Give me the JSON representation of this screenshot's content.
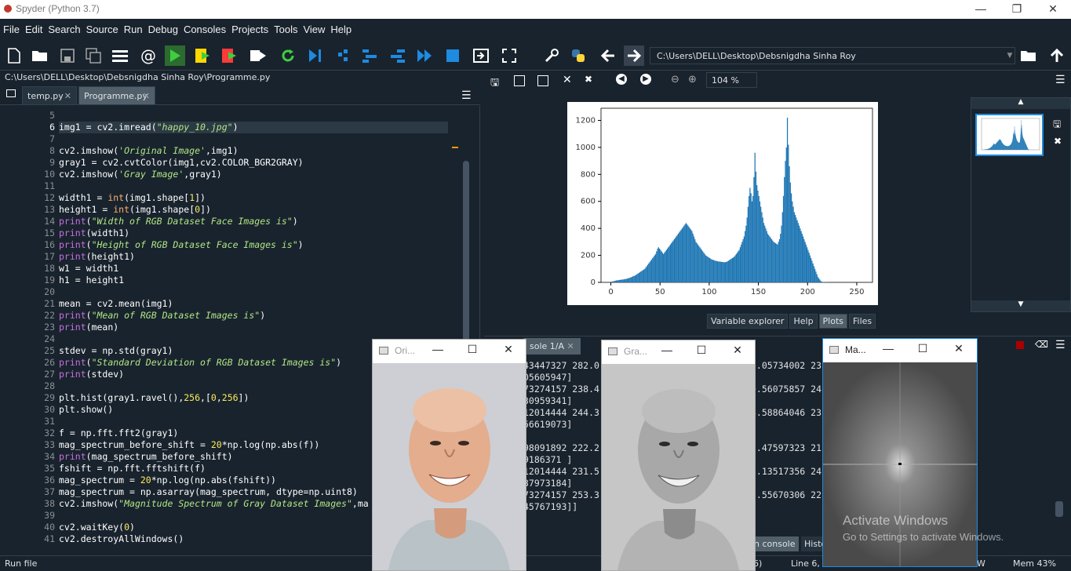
{
  "window": {
    "title": "Spyder (Python 3.7)",
    "min": "—",
    "max": "❐",
    "close": "✕"
  },
  "menu": [
    "File",
    "Edit",
    "Search",
    "Source",
    "Run",
    "Debug",
    "Consoles",
    "Projects",
    "Tools",
    "View",
    "Help"
  ],
  "toolbar": {
    "path": "C:\\Users\\DELL\\Desktop\\Debsnigdha Sinha Roy"
  },
  "editor": {
    "filepath": "C:\\Users\\DELL\\Desktop\\Debsnigdha Sinha Roy\\Programme.py",
    "tabs": [
      "temp.py",
      "Programme.py"
    ],
    "line_numbers": [
      "5",
      "6",
      "7",
      "8",
      "9",
      "10",
      "11",
      "12",
      "13",
      "14",
      "15",
      "16",
      "17",
      "18",
      "19",
      "20",
      "21",
      "22",
      "23",
      "24",
      "25",
      "26",
      "27",
      "28",
      "29",
      "30",
      "31",
      "32",
      "33",
      "34",
      "35",
      "36",
      "37",
      "38",
      "39",
      "40",
      "41"
    ]
  },
  "plots": {
    "zoom": "104 %",
    "tabs": [
      "Variable explorer",
      "Help",
      "Plots",
      "Files"
    ],
    "active_tab": "Plots"
  },
  "console": {
    "tab": "Console 1/A",
    "tab_visible": "sole 1/A",
    "lines": [
      "43447327 282.0",
      "05605947]",
      "73274157 238.4",
      "30959341]",
      "12014444 244.3",
      "56619073]",
      "",
      "98091892 222.2",
      "9186371 ]",
      "12014444 231.5",
      "37973184]",
      "73274157 253.3",
      "45767193]]"
    ],
    "lines_right": [
      "5.05734002 23",
      "",
      "0.56075857 24",
      "",
      "8.58864046 23",
      "",
      "",
      "5.47597323 21",
      "",
      "5.13517356 24",
      "",
      "5.55670306 22",
      ""
    ],
    "bottom_tabs": [
      "IPython console",
      "History"
    ],
    "bottom_tabs_visible": [
      "n console",
      "Histor"
    ]
  },
  "status": {
    "left": "Run file",
    "mid": "6)",
    "pos": "Line 6, C",
    "enc": "W",
    "mem": "Mem 43%"
  },
  "windows": [
    {
      "title": "Ori...",
      "full": "Original Image"
    },
    {
      "title": "Gra...",
      "full": "Gray Image"
    },
    {
      "title": "Ma...",
      "full": "Magnitude Spectrum of Gray Dataset Images"
    }
  ],
  "watermark": {
    "line1": "Activate Windows",
    "line2": "Go to Settings to activate Windows."
  },
  "chart_data": {
    "type": "bar",
    "title": "",
    "xlabel": "",
    "ylabel": "",
    "xlim": [
      -10,
      266
    ],
    "ylim": [
      0,
      1290
    ],
    "xticks": [
      "0",
      "50",
      "100",
      "150",
      "200",
      "250"
    ],
    "yticks": [
      "0",
      "200",
      "400",
      "600",
      "800",
      "1000",
      "1200"
    ],
    "color": "#1f77b4",
    "bins_start": 0,
    "values": [
      5,
      6,
      8,
      10,
      12,
      14,
      15,
      16,
      18,
      18,
      20,
      20,
      22,
      22,
      25,
      25,
      28,
      30,
      32,
      35,
      38,
      40,
      45,
      48,
      50,
      55,
      60,
      65,
      70,
      75,
      80,
      85,
      90,
      95,
      100,
      110,
      120,
      130,
      140,
      150,
      160,
      170,
      180,
      190,
      200,
      210,
      230,
      250,
      260,
      250,
      240,
      230,
      220,
      210,
      220,
      230,
      240,
      250,
      260,
      270,
      280,
      290,
      300,
      310,
      320,
      330,
      340,
      350,
      360,
      370,
      380,
      390,
      400,
      410,
      420,
      430,
      440,
      430,
      420,
      410,
      400,
      390,
      380,
      360,
      340,
      320,
      300,
      290,
      280,
      270,
      260,
      250,
      240,
      230,
      220,
      210,
      200,
      195,
      190,
      185,
      180,
      175,
      170,
      168,
      165,
      162,
      160,
      158,
      156,
      155,
      154,
      153,
      152,
      151,
      150,
      149,
      150,
      152,
      155,
      160,
      165,
      170,
      175,
      180,
      185,
      190,
      200,
      210,
      220,
      230,
      240,
      260,
      280,
      300,
      320,
      340,
      380,
      420,
      480,
      560,
      640,
      700,
      660,
      600,
      640,
      780,
      960,
      820,
      720,
      680,
      640,
      600,
      560,
      520,
      480,
      440,
      420,
      400,
      380,
      360,
      350,
      340,
      330,
      320,
      310,
      300,
      295,
      290,
      285,
      280,
      300,
      320,
      360,
      420,
      520,
      640,
      780,
      900,
      1000,
      1220,
      1020,
      860,
      740,
      660,
      600,
      560,
      520,
      500,
      480,
      460,
      440,
      420,
      400,
      380,
      360,
      340,
      320,
      300,
      280,
      260,
      240,
      220,
      200,
      180,
      160,
      140,
      120,
      100,
      80,
      60,
      40,
      30,
      20,
      10,
      5,
      3,
      2,
      1,
      1,
      1,
      0,
      0,
      0,
      0,
      0,
      0,
      0,
      0,
      0,
      0,
      0,
      0,
      0,
      0,
      0,
      0,
      0,
      0,
      0,
      0,
      0,
      0,
      0,
      0,
      0,
      0,
      0,
      0,
      0,
      0,
      0,
      0,
      0,
      0,
      0,
      0,
      0,
      0,
      0,
      0
    ]
  }
}
